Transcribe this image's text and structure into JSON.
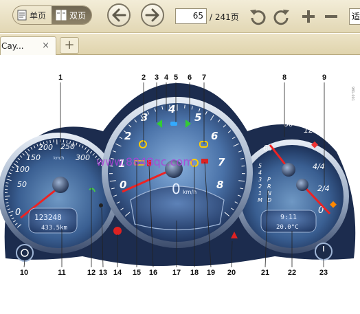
{
  "toolbar": {
    "single_page_label": "单页",
    "double_page_label": "双页",
    "current_page": "65",
    "total_pages": "/ 241页",
    "end_label": "适"
  },
  "tab": {
    "title": "Cay...",
    "close_label": "×",
    "new_tab_label": "+"
  },
  "figure": {
    "callouts": [
      "1",
      "2",
      "3",
      "4",
      "5",
      "6",
      "7",
      "8",
      "9",
      "10",
      "11",
      "12",
      "13",
      "14",
      "15",
      "16",
      "17",
      "18",
      "19",
      "20",
      "21",
      "22",
      "23"
    ],
    "speedometer": {
      "unit": "km/h",
      "ticks": [
        "0",
        "50",
        "100",
        "150",
        "200",
        "250",
        "300"
      ],
      "odometer": "123248",
      "trip": "433.5km"
    },
    "tachometer": {
      "ticks": [
        "0",
        "1",
        "2",
        "3",
        "4",
        "5",
        "6",
        "7",
        "8"
      ],
      "digital_speed": "0",
      "digital_unit": "km/h"
    },
    "right_gauge": {
      "temp_ticks": [
        "80",
        "120",
        "60"
      ],
      "fuel_ticks": [
        "4/4",
        "2/4",
        "0"
      ],
      "gears": [
        "5",
        "4",
        "3",
        "2",
        "1",
        "M"
      ],
      "modes": [
        "P",
        "R",
        "N",
        "D"
      ],
      "clock": "9:11",
      "outside_temp": "20.0°C"
    },
    "watermark": "www.8848qc.com",
    "side_code": "981-001"
  }
}
